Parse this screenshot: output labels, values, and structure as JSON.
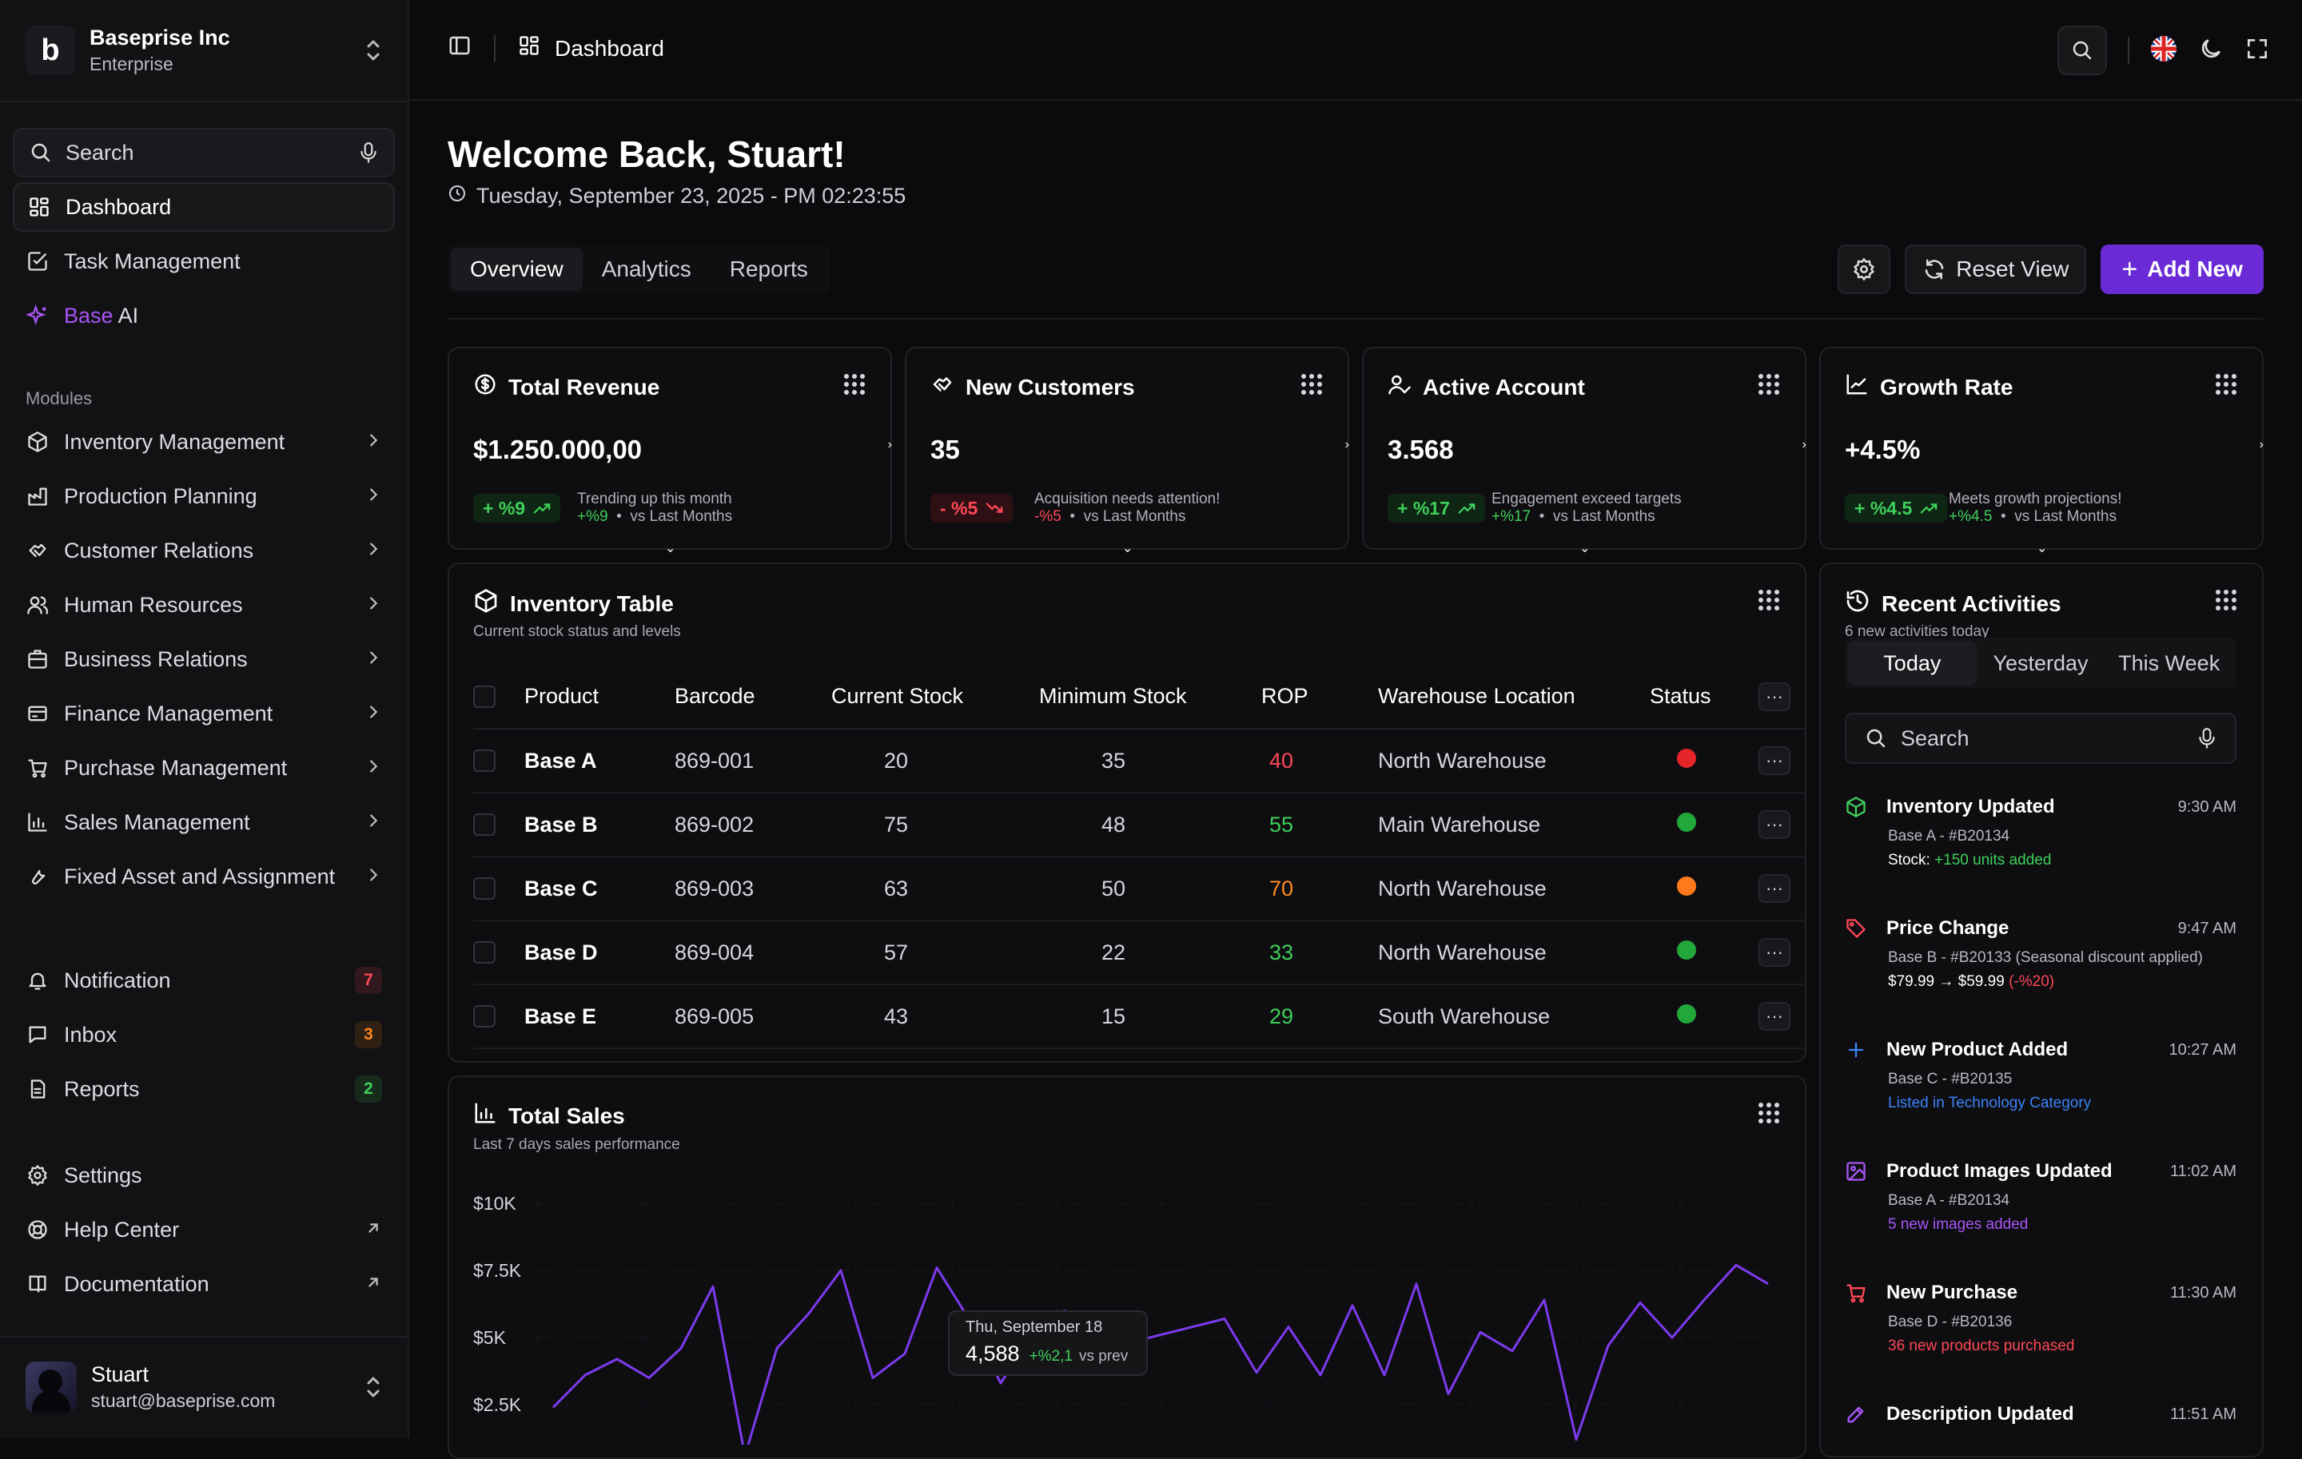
{
  "org": {
    "name": "Baseprise Inc",
    "plan": "Enterprise",
    "logo": "b"
  },
  "sidebar": {
    "search_label": "Search",
    "top_items": [
      {
        "label": "Dashboard",
        "icon": "grid-icon"
      },
      {
        "label": "Task Management",
        "icon": "checkbox-icon"
      },
      {
        "label_prefix": "Base",
        "label_suffix": "AI",
        "icon": "sparkle-icon"
      }
    ],
    "modules_label": "Modules",
    "modules": [
      {
        "label": "Inventory Management"
      },
      {
        "label": "Production Planning"
      },
      {
        "label": "Customer Relations"
      },
      {
        "label": "Human Resources"
      },
      {
        "label": "Business Relations"
      },
      {
        "label": "Finance Management"
      },
      {
        "label": "Purchase Management"
      },
      {
        "label": "Sales Management"
      },
      {
        "label": "Fixed Asset and Assignment"
      }
    ],
    "notify_items": [
      {
        "label": "Notification",
        "count": "7",
        "color": "#ff4757"
      },
      {
        "label": "Inbox",
        "count": "3",
        "color": "#ff8a1f"
      },
      {
        "label": "Reports",
        "count": "2",
        "color": "#3fcf5a"
      }
    ],
    "help_items": [
      {
        "label": "Settings"
      },
      {
        "label": "Help Center"
      },
      {
        "label": "Documentation"
      }
    ],
    "user": {
      "name": "Stuart",
      "email": "stuart@baseprise.com"
    }
  },
  "topbar": {
    "breadcrumb": "Dashboard"
  },
  "header": {
    "welcome": "Welcome Back, Stuart!",
    "datetime": "Tuesday, September 23, 2025 - PM 02:23:55",
    "tabs": [
      "Overview",
      "Analytics",
      "Reports"
    ],
    "reset_label": "Reset View",
    "add_label": "Add New"
  },
  "kpis": [
    {
      "title": "Total Revenue",
      "value": "$1.250.000,00",
      "pill": "+ %9",
      "dir": "up",
      "note": "Trending up this month",
      "sub_delta": "+%9",
      "sub_rest": "vs Last Months"
    },
    {
      "title": "New Customers",
      "value": "35",
      "pill": "- %5",
      "dir": "down",
      "note": "Acquisition needs attention!",
      "sub_delta": "-%5",
      "sub_rest": "vs Last Months"
    },
    {
      "title": "Active Account",
      "value": "3.568",
      "pill": "+ %17",
      "dir": "up",
      "note": "Engagement exceed targets",
      "sub_delta": "+%17",
      "sub_rest": "vs Last Months"
    },
    {
      "title": "Growth Rate",
      "value": "+4.5%",
      "pill": "+ %4.5",
      "dir": "up",
      "note": "Meets growth projections!",
      "sub_delta": "+%4.5",
      "sub_rest": "vs Last Months"
    }
  ],
  "inventory": {
    "title": "Inventory Table",
    "subtitle": "Current stock status and levels",
    "columns": [
      "Product",
      "Barcode",
      "Current Stock",
      "Minimum Stock",
      "ROP",
      "Warehouse Location",
      "Status"
    ],
    "rows": [
      {
        "product": "Base A",
        "barcode": "869-001",
        "current": "20",
        "minimum": "35",
        "rop": "40",
        "rop_color": "#ff4757",
        "location": "North Warehouse",
        "status_color": "#e5252a"
      },
      {
        "product": "Base B",
        "barcode": "869-002",
        "current": "75",
        "minimum": "48",
        "rop": "55",
        "rop_color": "#3fcf5a",
        "location": "Main Warehouse",
        "status_color": "#22a83a"
      },
      {
        "product": "Base C",
        "barcode": "869-003",
        "current": "63",
        "minimum": "50",
        "rop": "70",
        "rop_color": "#ff8a1f",
        "location": "North Warehouse",
        "status_color": "#ff7a1a"
      },
      {
        "product": "Base D",
        "barcode": "869-004",
        "current": "57",
        "minimum": "22",
        "rop": "33",
        "rop_color": "#3fcf5a",
        "location": "North Warehouse",
        "status_color": "#22a83a"
      },
      {
        "product": "Base E",
        "barcode": "869-005",
        "current": "43",
        "minimum": "15",
        "rop": "29",
        "rop_color": "#3fcf5a",
        "location": "South Warehouse",
        "status_color": "#22a83a"
      }
    ]
  },
  "sales": {
    "title": "Total Sales",
    "subtitle": "Last 7 days sales performance",
    "tooltip": {
      "date": "Thu, September 18",
      "value": "4,588",
      "delta": "+%2,1",
      "rest": "vs prev"
    }
  },
  "chart_data": {
    "type": "line",
    "y_ticks": [
      "$10K",
      "$7.5K",
      "$5K",
      "$2.5K"
    ],
    "ylim": [
      0,
      10000
    ],
    "series": [
      {
        "values": [
          2400,
          3600,
          4200,
          3500,
          4600,
          6900,
          600,
          4600,
          5900,
          7500,
          3500,
          4400,
          7600,
          5700,
          3300,
          5200,
          6000,
          4588,
          4800,
          5100,
          5400,
          5700,
          3700,
          5400,
          3600,
          6200,
          3600,
          7000,
          2900,
          5200,
          4500,
          6400,
          1200,
          4700,
          6300,
          5000,
          6400,
          7700,
          7000
        ]
      }
    ],
    "color": "#7c3aed"
  },
  "activities": {
    "title": "Recent Activities",
    "subtitle": "6 new activities today",
    "segments": [
      "Today",
      "Yesterday",
      "This Week"
    ],
    "search_label": "Search",
    "items": [
      {
        "title": "Inventory Updated",
        "time": "9:30 AM",
        "line": "Base A - #B20134",
        "detail_prefix": "Stock: ",
        "detail": "+150 units added",
        "detail_color": "#3fcf5a",
        "icon": "box-icon",
        "icon_color": "#3fcf5a"
      },
      {
        "title": "Price Change",
        "time": "9:47 AM",
        "line": "Base B - #B20133 (Seasonal discount applied)",
        "detail_prefix": "$79.99 → $59.99 ",
        "detail": "(-%20)",
        "detail_color": "#ff4757",
        "icon": "tag-icon",
        "icon_color": "#ff4757"
      },
      {
        "title": "New Product Added",
        "time": "10:27 AM",
        "line": "Base C - #B20135",
        "detail_prefix": "",
        "detail": "Listed in Technology Category",
        "detail_color": "#3b82f6",
        "icon": "plus-icon",
        "icon_color": "#3b82f6"
      },
      {
        "title": "Product Images Updated",
        "time": "11:02 AM",
        "line": "Base A - #B20134",
        "detail_prefix": "",
        "detail": "5 new images added",
        "detail_color": "#a855f7",
        "icon": "image-icon",
        "icon_color": "#a855f7"
      },
      {
        "title": "New Purchase",
        "time": "11:30 AM",
        "line": "Base D - #B20136",
        "detail_prefix": "",
        "detail": "36 new products purchased",
        "detail_color": "#ff4757",
        "icon": "cart-icon",
        "icon_color": "#ff4757"
      },
      {
        "title": "Description Updated",
        "time": "11:51 AM",
        "line": "",
        "detail_prefix": "",
        "detail": "",
        "detail_color": "#a855f7",
        "icon": "edit-icon",
        "icon_color": "#a855f7"
      }
    ]
  }
}
